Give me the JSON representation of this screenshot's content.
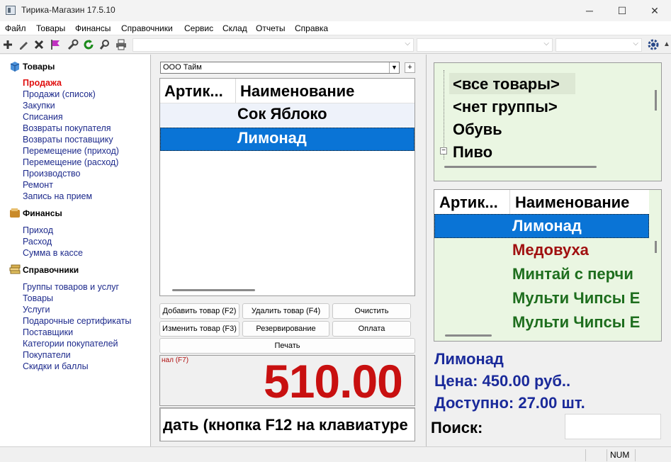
{
  "window": {
    "title": "Тирика-Магазин 17.5.10",
    "buttons": {
      "minimize": "─",
      "maximize": "☐",
      "close": "✕"
    }
  },
  "menu": [
    "Файл",
    "Товары",
    "Финансы",
    "Справочники",
    "Сервис",
    "Склад",
    "Отчеты",
    "Справка"
  ],
  "toolbar": {
    "icons": [
      "plus-icon",
      "pencil-icon",
      "delete-icon",
      "flag-icon",
      "wrench-icon",
      "refresh-icon",
      "search-icon",
      "printer-icon",
      "settings-icon"
    ]
  },
  "sidebar": {
    "sections": [
      {
        "title": "Товары",
        "icon": "box-icon",
        "items": [
          "Продажа",
          "Продажи (список)",
          "Закупки",
          "Списания",
          "Возвраты покупателя",
          "Возвраты поставщику",
          "Перемещение (приход)",
          "Перемещение (расход)",
          "Производство",
          "Ремонт",
          "Запись на прием"
        ]
      },
      {
        "title": "Финансы",
        "icon": "wallet-icon",
        "items": [
          "Приход",
          "Расход",
          "Сумма в кассе"
        ]
      },
      {
        "title": "Справочники",
        "icon": "books-icon",
        "items": [
          "Группы товаров и услуг",
          "Товары",
          "Услуги",
          "Подарочные сертификаты",
          "Поставщики",
          "Категории покупателей",
          "Покупатели",
          "Скидки и баллы"
        ]
      }
    ],
    "active_item": "Продажа"
  },
  "sale": {
    "organization": "ООО Тайм",
    "add_label": "+",
    "columns": [
      "Артик...",
      "Наименование"
    ],
    "rows": [
      {
        "article": "",
        "name": "Сок Яблоко"
      },
      {
        "article": "",
        "name": "Лимонад"
      }
    ],
    "selected_row": 1,
    "buttons": {
      "add": "Добавить товар (F2)",
      "remove": "Удалить товар (F4)",
      "clear": "Очистить",
      "edit": "Изменить товар (F3)",
      "reserve": "Резервирование",
      "pay": "Оплата",
      "print": "Печать"
    },
    "total_label": "нал (F7)",
    "total": "510.00",
    "hint": "дать (кнопка F12 на клавиатуре"
  },
  "groups": {
    "items": [
      "<все товары>",
      "<нет группы>",
      "Обувь",
      "Пиво"
    ]
  },
  "catalog": {
    "columns": [
      "Артик...",
      "Наименование"
    ],
    "rows": [
      {
        "name": "Лимонад",
        "color": "#ffffff"
      },
      {
        "name": "Медовуха",
        "color": "#a01010"
      },
      {
        "name": "Минтай с перчи",
        "color": "#1e6e1e"
      },
      {
        "name": "Мульти Чипсы Е",
        "color": "#1e6e1e"
      },
      {
        "name": "Мульти Чипсы Е",
        "color": "#1e6e1e"
      }
    ],
    "selected_row": 0
  },
  "details": {
    "name": "Лимонад",
    "price": "Цена: 450.00 руб..",
    "available": "Доступно: 27.00 шт."
  },
  "search": {
    "label": "Поиск:",
    "value": ""
  },
  "status": {
    "num": "NUM"
  },
  "colors": {
    "selection": "#0a74d6",
    "detail_text": "#1a2a9a",
    "group_bg": "#eaf6e2"
  }
}
